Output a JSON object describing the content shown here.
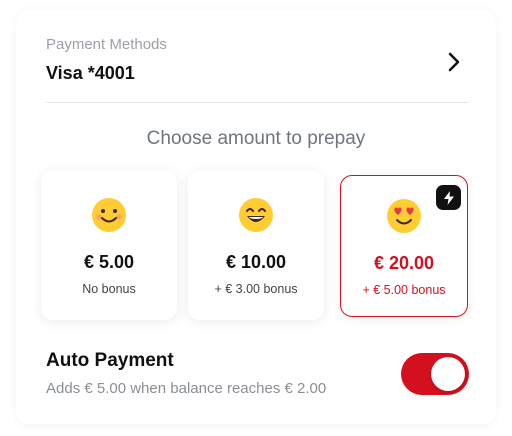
{
  "payment_methods": {
    "label": "Payment Methods",
    "value": "Visa *4001"
  },
  "prepay": {
    "title": "Choose amount to prepay",
    "options": [
      {
        "amount": "€ 5.00",
        "bonus": "No bonus",
        "emoji": "smiling-face-icon",
        "selected": false
      },
      {
        "amount": "€ 10.00",
        "bonus": "+ € 3.00 bonus",
        "emoji": "grinning-face-icon",
        "selected": false
      },
      {
        "amount": "€ 20.00",
        "bonus": "+ € 5.00 bonus",
        "emoji": "heart-eyes-face-icon",
        "selected": true,
        "badge": "lightning-icon"
      }
    ]
  },
  "auto_payment": {
    "title": "Auto Payment",
    "description": "Adds € 5.00 when balance reaches € 2.00",
    "enabled": true
  },
  "colors": {
    "accent": "#d40f1e",
    "emoji_yellow": "#ffcc33",
    "text_primary": "#111111",
    "text_secondary": "#8a8f95"
  }
}
